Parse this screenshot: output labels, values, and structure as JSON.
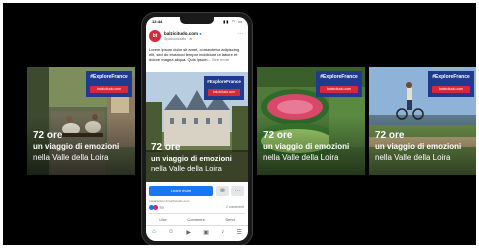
{
  "cards": [
    {
      "hashtag": "#ExploreFrance",
      "url": "balzicitudo.com",
      "line1": "72 ore",
      "line2": "un viaggio di emozioni",
      "line3": "nella Valle della Loira"
    },
    {
      "hashtag": "#ExploreFrance",
      "url": "balzicitudo.com",
      "line1": "72 ore",
      "line2": "un viaggio di emozioni",
      "line3": "nella Valle della Loira"
    },
    {
      "hashtag": "#ExploreFrance",
      "url": "balzicitudo.com",
      "line1": "72 ore",
      "line2": "un viaggio di emozioni",
      "line3": "nella Valle della Loira"
    },
    {
      "hashtag": "#ExploreFrance",
      "url": "balzicitudo.com",
      "line1": "72 ore",
      "line2": "un viaggio di emozioni",
      "line3": "nella Valle della Loira"
    }
  ],
  "phone": {
    "status_time": "12:44",
    "status_icons": "▮▮ ◠ ▭",
    "logo_text": "bt",
    "page_name": "balzicitudo.com",
    "sponsored": "Sponsorizzato · ⊕",
    "more_dots": "···",
    "caption": "Lorem ipsum dolor sit amet, consectetur adipiscing elit, sed do eiusmod tempor incididunt ut labore et dolore magna aliqua. Quis ipsum...",
    "caption_more": "See more",
    "cta_label": "Learn more",
    "message_icon": "✉",
    "more_icon": "···",
    "sub_note": "Installazioni di balzicitudo.com",
    "reaction_count": "79",
    "comments": "2 commenti",
    "actions": [
      "Like",
      "Comment",
      "Send"
    ],
    "nav_icons": [
      "⌂",
      "☺",
      "▶",
      "▣",
      "♪",
      "☰"
    ]
  }
}
